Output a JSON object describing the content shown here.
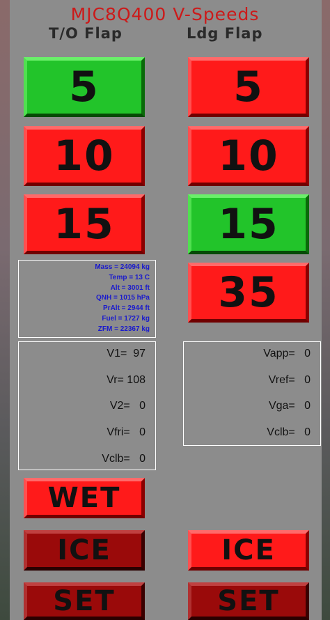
{
  "title": "MJC8Q400 V-Speeds",
  "headers": {
    "takeoff": "T/O Flap",
    "landing": "Ldg Flap"
  },
  "takeoff_flaps": [
    "5",
    "10",
    "15"
  ],
  "landing_flaps": [
    "5",
    "10",
    "15",
    "35"
  ],
  "selected": {
    "takeoff_flap": "5",
    "landing_flap": "15"
  },
  "colors": {
    "selected": "#22c42a",
    "unselected": "#ff1a1a",
    "inactive": "#9a0a0a",
    "title": "#cc1a1a",
    "info_text": "#1a1acc"
  },
  "info": {
    "mass": "Mass = 24094 kg",
    "temp": "Temp = 13 C",
    "alt": "Alt = 3001 ft",
    "qnh": "QNH = 1015 hPa",
    "pralt": "PrAlt = 2944 ft",
    "fuel": "Fuel = 1727 kg",
    "zfm": "ZFM = 22367 kg"
  },
  "takeoff_speeds": {
    "v1": "V1=  97",
    "vr": "Vr= 108",
    "v2": "V2=   0",
    "vfri": "Vfri=   0",
    "vclb": "Vclb=   0"
  },
  "landing_speeds": {
    "vapp": "Vapp=   0",
    "vref": "Vref=   0",
    "vga": "Vga=   0",
    "vclb": "Vclb=   0"
  },
  "buttons": {
    "wet": "WET",
    "ice_to": "ICE",
    "ice_ldg": "ICE",
    "set_to": "SET",
    "set_ldg": "SET"
  }
}
